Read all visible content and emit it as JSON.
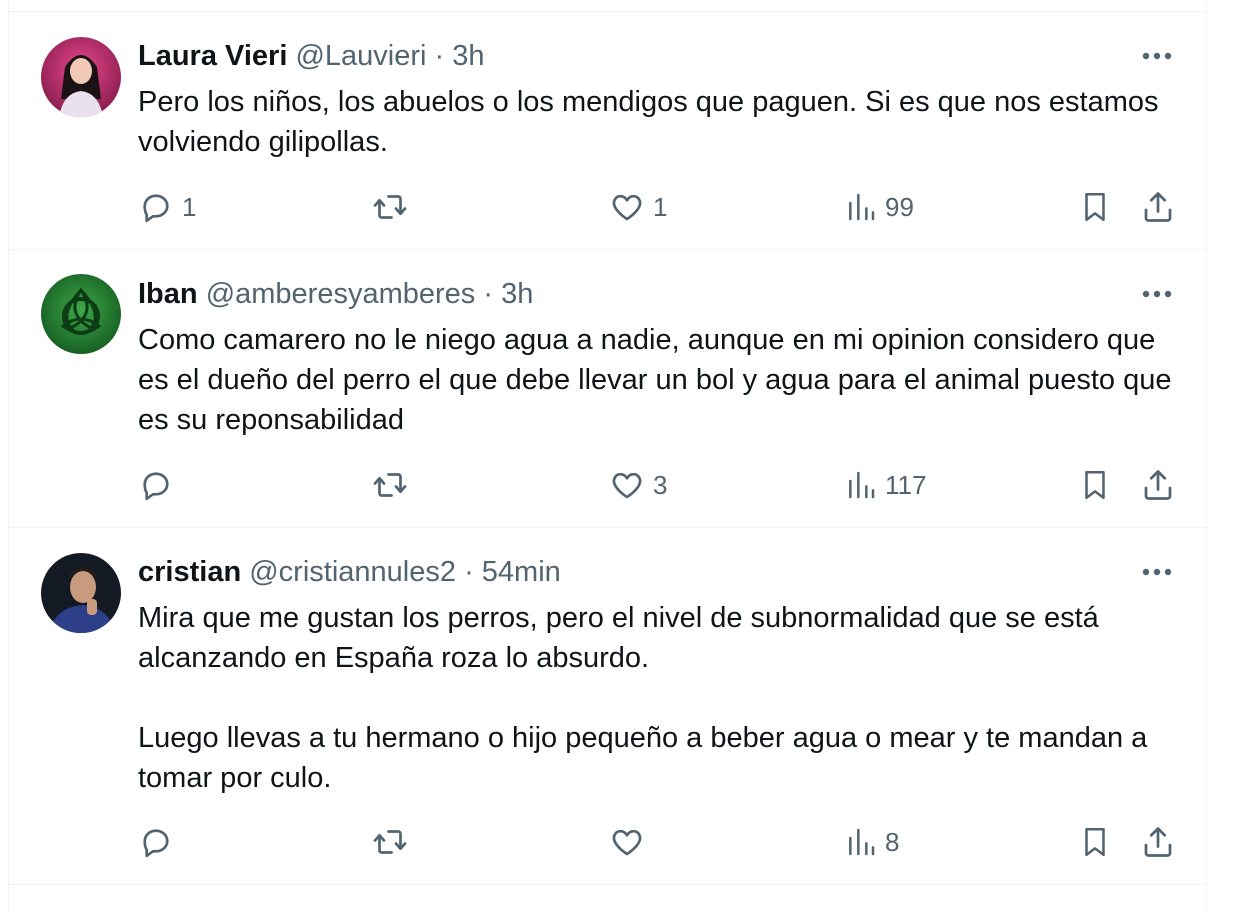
{
  "tweets": [
    {
      "name": "Laura Vieri",
      "handle": "@Lauvieri",
      "separator": "·",
      "time": "3h",
      "text": "Pero los niños, los abuelos o los mendigos que paguen. Si es que nos estamos volviendo gilipollas.",
      "replies": "1",
      "retweets": "",
      "likes": "1",
      "views": "99",
      "avatar": "profile-photo-woman-pink"
    },
    {
      "name": "Iban",
      "handle": "@amberesyamberes",
      "separator": "·",
      "time": "3h",
      "text": "Como camarero no le niego agua a nadie, aunque en mi opinion considero que es el dueño del perro el que debe llevar un bol y agua para el animal puesto que es su reponsabilidad",
      "replies": "",
      "retweets": "",
      "likes": "3",
      "views": "117",
      "avatar": "green-celtic-knot"
    },
    {
      "name": "cristian",
      "handle": "@cristiannules2",
      "separator": "·",
      "time": "54min",
      "text": "Mira que me gustan los perros, pero el nivel de subnormalidad que se está alcanzando en España roza lo absurdo.\n\nLuego llevas a tu hermano o hijo pequeño a beber agua o mear y te mandan a tomar por culo.",
      "replies": "",
      "retweets": "",
      "likes": "",
      "views": "8",
      "avatar": "profile-photo-man-dark"
    }
  ],
  "colors": {
    "text": "#0f1419",
    "secondary": "#536471",
    "border": "#eff3f4",
    "icon": "#536471"
  }
}
